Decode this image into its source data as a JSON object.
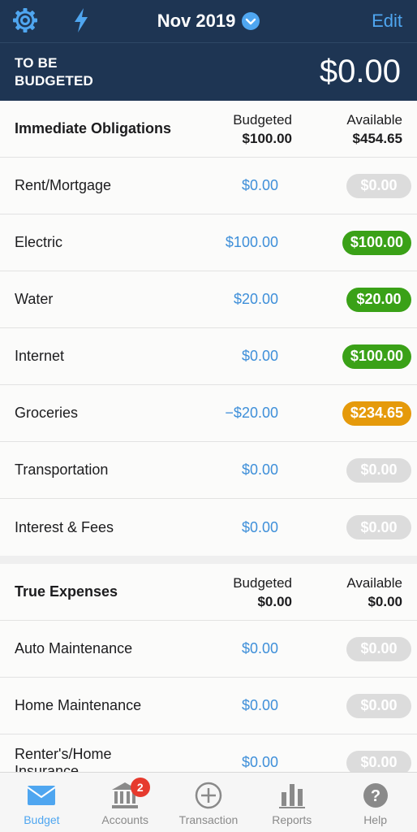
{
  "header": {
    "month": "Nov 2019",
    "edit_label": "Edit"
  },
  "to_be_budgeted": {
    "label": "TO BE BUDGETED",
    "amount": "$0.00"
  },
  "groups": [
    {
      "name": "Immediate Obligations",
      "budgeted_label": "Budgeted",
      "budgeted": "$100.00",
      "available_label": "Available",
      "available": "$454.65",
      "categories": [
        {
          "name": "Rent/Mortgage",
          "budgeted": "$0.00",
          "available": "$0.00",
          "status": "zero"
        },
        {
          "name": "Electric",
          "budgeted": "$100.00",
          "available": "$100.00",
          "status": "green"
        },
        {
          "name": "Water",
          "budgeted": "$20.00",
          "available": "$20.00",
          "status": "green"
        },
        {
          "name": "Internet",
          "budgeted": "$0.00",
          "available": "$100.00",
          "status": "green"
        },
        {
          "name": "Groceries",
          "budgeted": "−$20.00",
          "available": "$234.65",
          "status": "orange"
        },
        {
          "name": "Transportation",
          "budgeted": "$0.00",
          "available": "$0.00",
          "status": "zero"
        },
        {
          "name": "Interest & Fees",
          "budgeted": "$0.00",
          "available": "$0.00",
          "status": "zero"
        }
      ]
    },
    {
      "name": "True Expenses",
      "budgeted_label": "Budgeted",
      "budgeted": "$0.00",
      "available_label": "Available",
      "available": "$0.00",
      "categories": [
        {
          "name": "Auto Maintenance",
          "budgeted": "$0.00",
          "available": "$0.00",
          "status": "zero"
        },
        {
          "name": "Home Maintenance",
          "budgeted": "$0.00",
          "available": "$0.00",
          "status": "zero"
        },
        {
          "name": "Renter's/Home Insurance",
          "budgeted": "$0.00",
          "available": "$0.00",
          "status": "zero"
        }
      ]
    }
  ],
  "tabbar": {
    "items": [
      {
        "label": "Budget",
        "icon": "envelope-icon",
        "active": true
      },
      {
        "label": "Accounts",
        "icon": "bank-icon",
        "badge": "2"
      },
      {
        "label": "Transaction",
        "icon": "plus-circle-icon"
      },
      {
        "label": "Reports",
        "icon": "bar-chart-icon"
      },
      {
        "label": "Help",
        "icon": "question-icon"
      }
    ]
  },
  "colors": {
    "header_bg": "#1e3553",
    "accent": "#4fa6f0",
    "budget_blue": "#3e8fd9",
    "positive": "#3aa117",
    "warning": "#e59a0b",
    "zero": "#dcdcdc",
    "badge": "#e63a2e"
  }
}
